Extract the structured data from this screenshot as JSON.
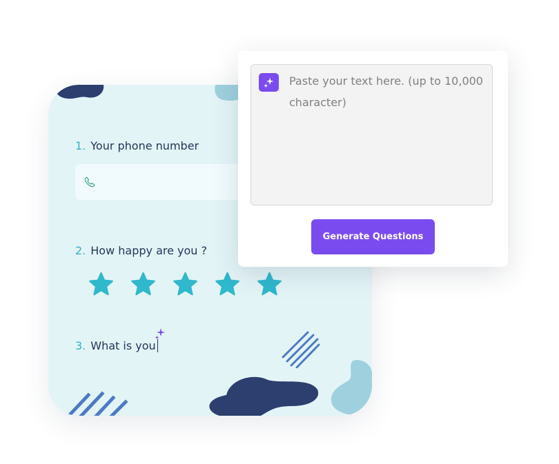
{
  "form": {
    "questions": [
      {
        "number": "1.",
        "label": "Your phone number"
      },
      {
        "number": "2.",
        "label": "How happy are you ?"
      },
      {
        "number": "3.",
        "label": "What is you"
      }
    ],
    "phone_icon": "phone-icon",
    "rating": {
      "stars": 5,
      "icon": "star-icon",
      "color": "#30b8cc"
    },
    "sparkle_icon": "sparkle-icon"
  },
  "generator": {
    "icon": "ai-sparkle-icon",
    "placeholder": "Paste your text here. (up to 10,000 character)",
    "button_label": "Generate Questions"
  },
  "colors": {
    "accent": "#7a4cf0",
    "card_bg": "#e3f4f7",
    "question_number": "#30b3c5",
    "question_text": "#23365a",
    "dark_blob": "#2c3f6e",
    "light_blob": "#9fd0de",
    "stripes": "#4e79c4"
  }
}
